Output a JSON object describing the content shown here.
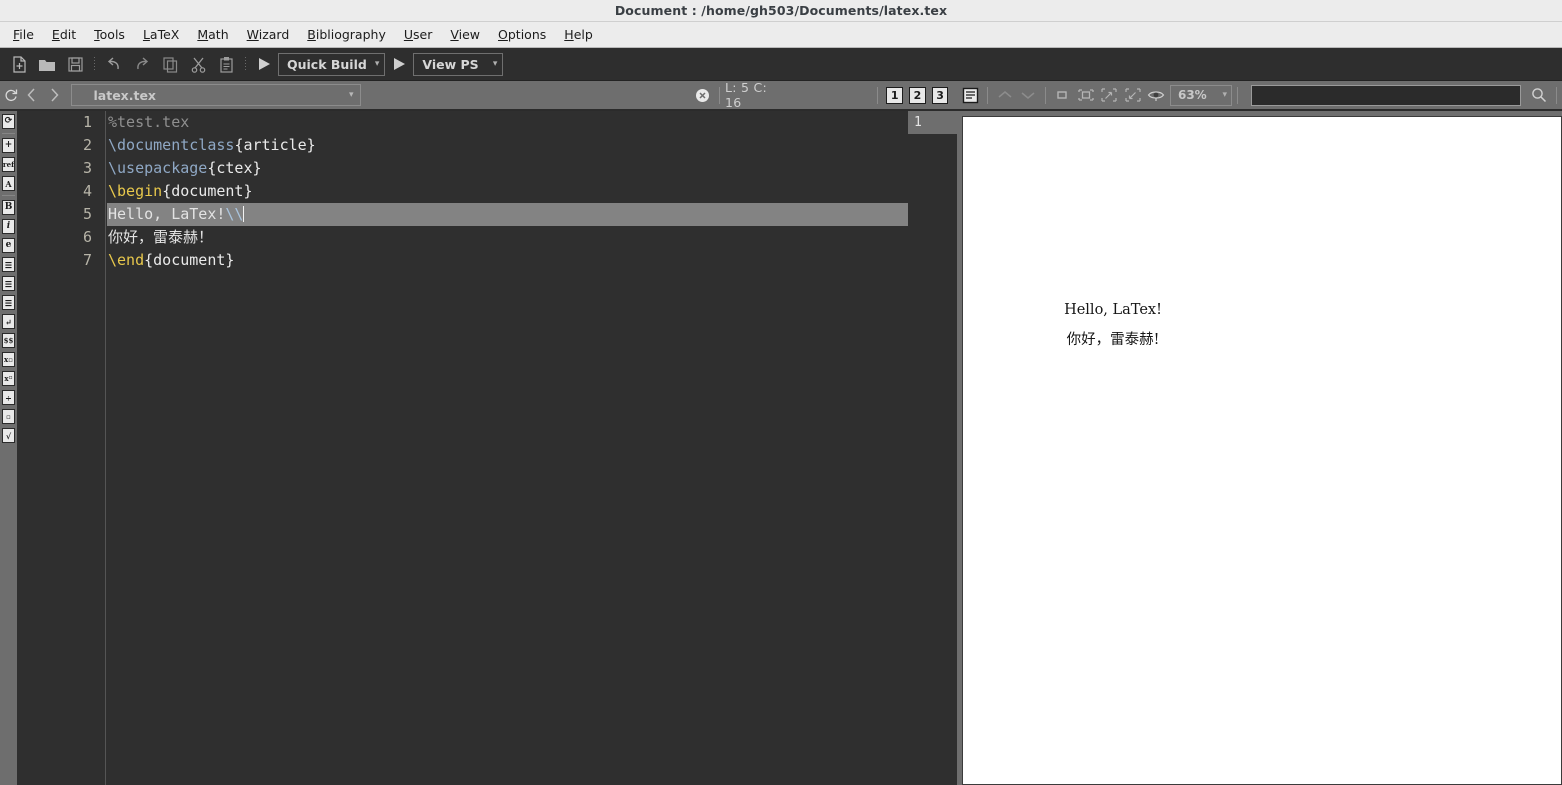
{
  "window": {
    "title": "Document : /home/gh503/Documents/latex.tex"
  },
  "menubar": {
    "items": [
      {
        "label": "File",
        "mnemonic": "F"
      },
      {
        "label": "Edit",
        "mnemonic": "E"
      },
      {
        "label": "Tools",
        "mnemonic": "T"
      },
      {
        "label": "LaTeX",
        "mnemonic": "L"
      },
      {
        "label": "Math",
        "mnemonic": "M"
      },
      {
        "label": "Wizard",
        "mnemonic": "W"
      },
      {
        "label": "Bibliography",
        "mnemonic": "B"
      },
      {
        "label": "User",
        "mnemonic": "U"
      },
      {
        "label": "View",
        "mnemonic": "V"
      },
      {
        "label": "Options",
        "mnemonic": "O"
      },
      {
        "label": "Help",
        "mnemonic": "H"
      }
    ]
  },
  "toolbar": {
    "icons": [
      "new-file-icon",
      "open-folder-icon",
      "save-icon",
      "undo-icon",
      "redo-icon",
      "copy-icon",
      "cut-icon",
      "paste-icon"
    ],
    "build_label": "Quick Build",
    "view_label": "View PS",
    "carat": "▾"
  },
  "statusbar": {
    "refresh_icon": "refresh-icon",
    "back_label": "‹",
    "forward_label": "›",
    "file_name": "latex.tex",
    "close_icon": "close-circle-icon",
    "cursor_position": "L: 5 C: 16",
    "view_modes": [
      "1",
      "2",
      "3"
    ],
    "structure_icon": "structure-list-icon",
    "prev_icon": "chevron-up-icon",
    "next_icon": "chevron-down-icon",
    "zoom_icons": [
      "fit-page-icon",
      "fit-width-icon",
      "zoom-in-icon",
      "zoom-out-icon",
      "eye-icon"
    ],
    "zoom_level": "63%",
    "search_value": "",
    "search_placeholder": "",
    "search_icon": "search-icon",
    "carat": "▾"
  },
  "leftrail": {
    "items": [
      {
        "name": "refresh-icon",
        "glyph": "⟳"
      },
      {
        "name": "insert-icon",
        "glyph": "+"
      },
      {
        "name": "reference-icon",
        "glyph": "ref"
      },
      {
        "name": "label-icon",
        "glyph": "A"
      },
      {
        "name": "bold-icon",
        "glyph": "B"
      },
      {
        "name": "italic-icon",
        "glyph": "i"
      },
      {
        "name": "emphasis-icon",
        "glyph": "e"
      },
      {
        "name": "align-left-icon",
        "glyph": "≡"
      },
      {
        "name": "align-center-icon",
        "glyph": "≡"
      },
      {
        "name": "align-justify-icon",
        "glyph": "≡"
      },
      {
        "name": "newline-icon",
        "glyph": "↵"
      },
      {
        "name": "math-display-icon",
        "glyph": "$$"
      },
      {
        "name": "subscript-icon",
        "glyph": "x▫"
      },
      {
        "name": "superscript-icon",
        "glyph": "x▫"
      },
      {
        "name": "fraction-icon",
        "glyph": "÷"
      },
      {
        "name": "binomial-icon",
        "glyph": "▫"
      },
      {
        "name": "sqrt-icon",
        "glyph": "√"
      }
    ]
  },
  "editor": {
    "line_numbers": [
      "1",
      "2",
      "3",
      "4",
      "5",
      "6",
      "7"
    ],
    "current_line": 5,
    "page_marker": "1",
    "lines": [
      {
        "n": 1,
        "text": "%test.tex"
      },
      {
        "n": 2,
        "text": "\\documentclass{article}"
      },
      {
        "n": 3,
        "text": "\\usepackage{ctex}"
      },
      {
        "n": 4,
        "text": "\\begin{document}"
      },
      {
        "n": 5,
        "text": "Hello, LaTex!\\\\"
      },
      {
        "n": 6,
        "text": "你好，雷泰赫！"
      },
      {
        "n": 7,
        "text": "\\end{document}"
      }
    ],
    "tokens": {
      "l1_comment": "%test.tex",
      "l2_cmd": "\\documentclass",
      "l2_arg": "{article}",
      "l3_cmd": "\\usepackage",
      "l3_arg": "{ctex}",
      "l4_kw": "\\begin",
      "l4_arg": "{document}",
      "l5_text": "Hello, LaTex!",
      "l5_break": "\\\\",
      "l6_text": "你好，雷泰赫！",
      "l7_kw": "\\end",
      "l7_arg": "{document}"
    }
  },
  "preview": {
    "line1": "Hello, LaTex!",
    "line2": "你好，雷泰赫!"
  },
  "colors": {
    "titlebar_bg": "#ececec",
    "toolbar_bg": "#2e2e2e",
    "statusbar_bg": "#6e6e6e",
    "editor_bg": "#2f2f2f",
    "current_line_bg": "#838383",
    "keyword": "#e8c84c",
    "command": "#8fa8c5",
    "comment": "#8f8f8f",
    "page_bg": "#ffffff"
  }
}
